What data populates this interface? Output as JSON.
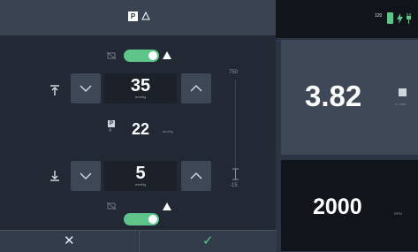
{
  "header": {
    "p_badge": "P",
    "battery_level": "120"
  },
  "upper": {
    "value": "35",
    "unit": "mmHg"
  },
  "center": {
    "value": "22",
    "unit": "mmHg",
    "p_badge": "P",
    "subscript": "A"
  },
  "lower": {
    "value": "5",
    "unit": "mmHg"
  },
  "scale": {
    "max": "750",
    "min": "-15"
  },
  "flow": {
    "value": "3.82",
    "unit": "L / min"
  },
  "speed": {
    "value": "2000",
    "unit": "RPM"
  },
  "footer": {
    "cancel_symbol": "✕",
    "confirm_symbol": "✓"
  },
  "colors": {
    "accent_green": "#5ec48a",
    "panel_dark": "#222934",
    "panel_mid": "#3f4856"
  },
  "icons": {
    "upper_limit": "arrow-up-to-line-icon",
    "lower_limit": "arrow-down-to-line-icon",
    "alarm": "alarm-bell-off-icon"
  }
}
